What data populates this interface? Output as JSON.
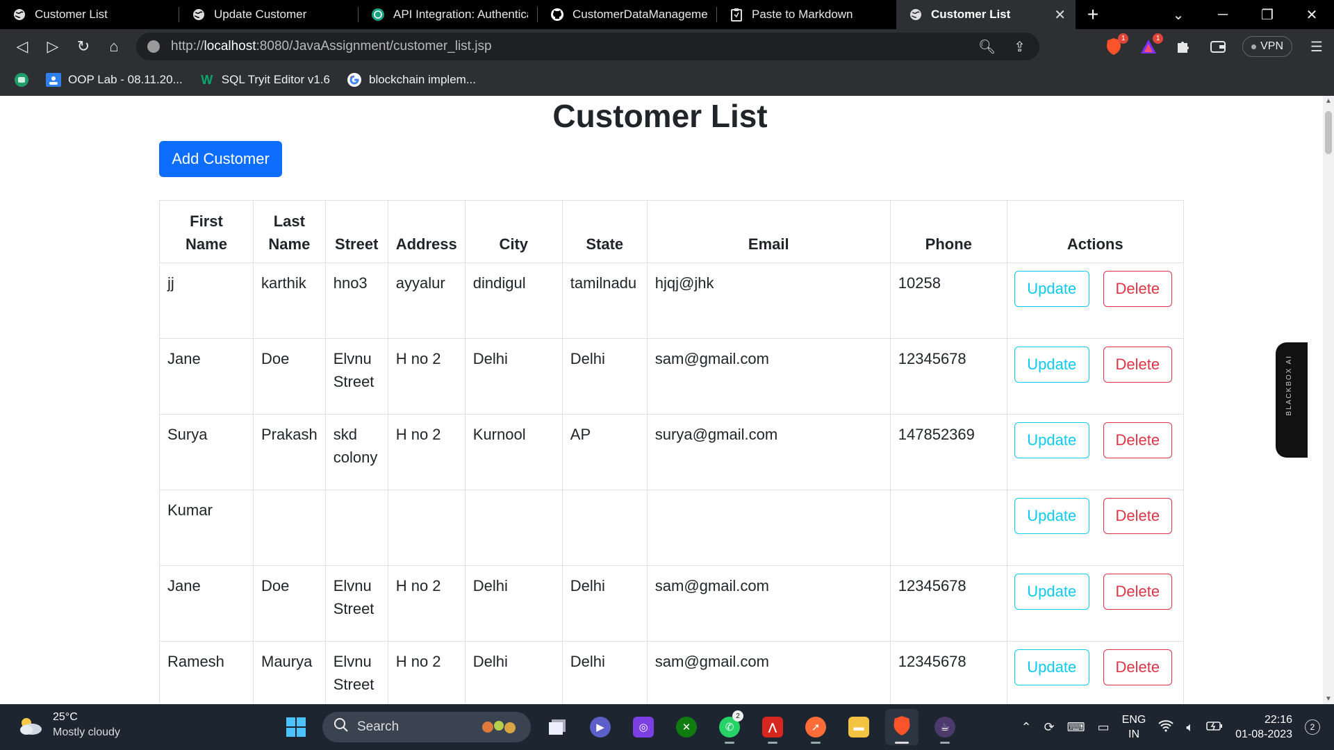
{
  "browser": {
    "tabs": [
      {
        "label": "Customer List",
        "icon": "globe-icon",
        "active": false
      },
      {
        "label": "Update Customer",
        "icon": "globe-icon",
        "active": false
      },
      {
        "label": "API Integration: Authenticat",
        "icon": "chatgpt-icon",
        "active": false
      },
      {
        "label": "CustomerDataManagement",
        "icon": "github-icon",
        "active": false
      },
      {
        "label": "Paste to Markdown",
        "icon": "clipboard-icon",
        "active": false
      },
      {
        "label": "Customer List",
        "icon": "globe-icon",
        "active": true
      }
    ],
    "url": {
      "prefix": "http://",
      "host": "localhost",
      "rest": ":8080/JavaAssignment/customer_list.jsp"
    },
    "extensions": {
      "brave_badge": "1",
      "rewards_badge": "1",
      "vpn_label": "VPN"
    },
    "bookmarks": [
      {
        "label": "OOP Lab - 08.11.20...",
        "icon": "classroom-icon"
      },
      {
        "label": "SQL Tryit Editor v1.6",
        "icon": "w3schools-icon"
      },
      {
        "label": "blockchain implem...",
        "icon": "google-icon"
      }
    ]
  },
  "page": {
    "title": "Customer List",
    "add_button": "Add Customer",
    "columns": [
      "First Name",
      "Last Name",
      "Street",
      "Address",
      "City",
      "State",
      "Email",
      "Phone",
      "Actions"
    ],
    "update_label": "Update",
    "delete_label": "Delete",
    "rows": [
      {
        "first": "jj",
        "last": "karthik",
        "street": "hno3",
        "address": "ayyalur",
        "city": "dindigul",
        "state": "tamilnadu",
        "email": "hjqj@jhk",
        "phone": "10258"
      },
      {
        "first": "Jane",
        "last": "Doe",
        "street": "Elvnu Street",
        "address": "H no 2",
        "city": "Delhi",
        "state": "Delhi",
        "email": "sam@gmail.com",
        "phone": "12345678"
      },
      {
        "first": "Surya",
        "last": "Prakash",
        "street": "skd colony",
        "address": "H no 2",
        "city": "Kurnool",
        "state": "AP",
        "email": "surya@gmail.com",
        "phone": "147852369"
      },
      {
        "first": "Kumar",
        "last": "",
        "street": "",
        "address": "",
        "city": "",
        "state": "",
        "email": "",
        "phone": ""
      },
      {
        "first": "Jane",
        "last": "Doe",
        "street": "Elvnu Street",
        "address": "H no 2",
        "city": "Delhi",
        "state": "Delhi",
        "email": "sam@gmail.com",
        "phone": "12345678"
      },
      {
        "first": "Ramesh",
        "last": "Maurya",
        "street": "Elvnu Street",
        "address": "H no 2",
        "city": "Delhi",
        "state": "Delhi",
        "email": "sam@gmail.com",
        "phone": "12345678"
      }
    ],
    "side_widget": "BLACKBOX AI"
  },
  "taskbar": {
    "temperature": "25°C",
    "weather": "Mostly cloudy",
    "search_placeholder": "Search",
    "whatsapp_count": "2",
    "lang_line1": "ENG",
    "lang_line2": "IN",
    "time": "22:16",
    "date": "01-08-2023",
    "notification_count": "2"
  },
  "colors": {
    "primary": "#0d6efd",
    "info": "#0dcaf0",
    "danger": "#dc3545",
    "chrome_bg": "#2d2f33",
    "taskbar_bg": "#1c2530"
  }
}
